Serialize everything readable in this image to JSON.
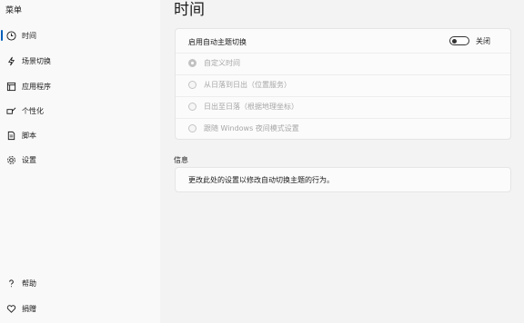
{
  "sidebar": {
    "menu_title": "菜单",
    "items": [
      {
        "label": "时间",
        "icon": "clock-icon",
        "active": true
      },
      {
        "label": "场景切换",
        "icon": "lightning-icon",
        "active": false
      },
      {
        "label": "应用程序",
        "icon": "apps-icon",
        "active": false
      },
      {
        "label": "个性化",
        "icon": "paint-brush-icon",
        "active": false
      },
      {
        "label": "脚本",
        "icon": "script-icon",
        "active": false
      },
      {
        "label": "设置",
        "icon": "gear-icon",
        "active": false
      }
    ],
    "footer": [
      {
        "label": "帮助",
        "icon": "help-icon"
      },
      {
        "label": "捐赠",
        "icon": "heart-icon"
      }
    ]
  },
  "main": {
    "title": "时间",
    "auto_switch": {
      "label": "启用自动主题切换",
      "toggle_state_label": "关闭",
      "enabled": false
    },
    "options": [
      {
        "label": "自定义时间",
        "checked": true
      },
      {
        "label": "从日落到日出（位置服务）",
        "checked": false
      },
      {
        "label": "日出至日落（根据地理坐标）",
        "checked": false
      },
      {
        "label": "跟随 Windows 夜间模式设置",
        "checked": false
      }
    ],
    "info": {
      "section_title": "信息",
      "text": "更改此处的设置以修改自动切换主题的行为。"
    }
  },
  "colors": {
    "accent": "#005fb8",
    "window_bg": "#f3f3f3",
    "card_bg": "#fbfbfb",
    "disabled_text": "#a7a7a7"
  }
}
